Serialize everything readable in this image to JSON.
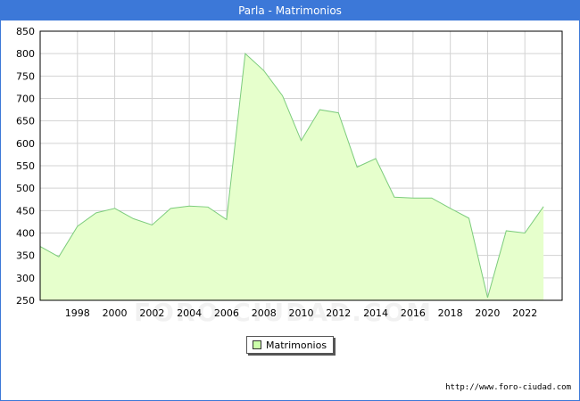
{
  "chart_data": {
    "type": "area",
    "title": "Parla - Matrimonios",
    "x": [
      1996,
      1997,
      1998,
      1999,
      2000,
      2001,
      2002,
      2003,
      2004,
      2005,
      2006,
      2007,
      2008,
      2009,
      2010,
      2011,
      2012,
      2013,
      2014,
      2015,
      2016,
      2017,
      2018,
      2019,
      2020,
      2021,
      2022,
      2023
    ],
    "series": [
      {
        "name": "Matrimonios",
        "values": [
          370,
          347,
          415,
          445,
          455,
          432,
          418,
          455,
          460,
          458,
          430,
          800,
          762,
          706,
          606,
          675,
          668,
          547,
          566,
          480,
          478,
          478,
          455,
          433,
          256,
          405,
          400,
          459
        ]
      }
    ],
    "xticks": [
      1998,
      2000,
      2002,
      2004,
      2006,
      2008,
      2010,
      2012,
      2014,
      2016,
      2018,
      2020,
      2022
    ],
    "yticks": [
      250,
      300,
      350,
      400,
      450,
      500,
      550,
      600,
      650,
      700,
      750,
      800,
      850
    ],
    "xlim": [
      1996,
      2024
    ],
    "ylim": [
      250,
      850
    ],
    "xlabel": "",
    "ylabel": "",
    "grid": true,
    "legend": "bottom-center",
    "colors": {
      "fill": "#e6ffcc",
      "line": "#7ccc7c",
      "grid": "#d3d3d3",
      "title_bar": "#3c78d8",
      "legend_swatch": "#ccffaa"
    }
  },
  "legend_label": "Matrimonios",
  "watermark": "FORO-CIUDAD.COM",
  "source": "http://www.foro-ciudad.com"
}
